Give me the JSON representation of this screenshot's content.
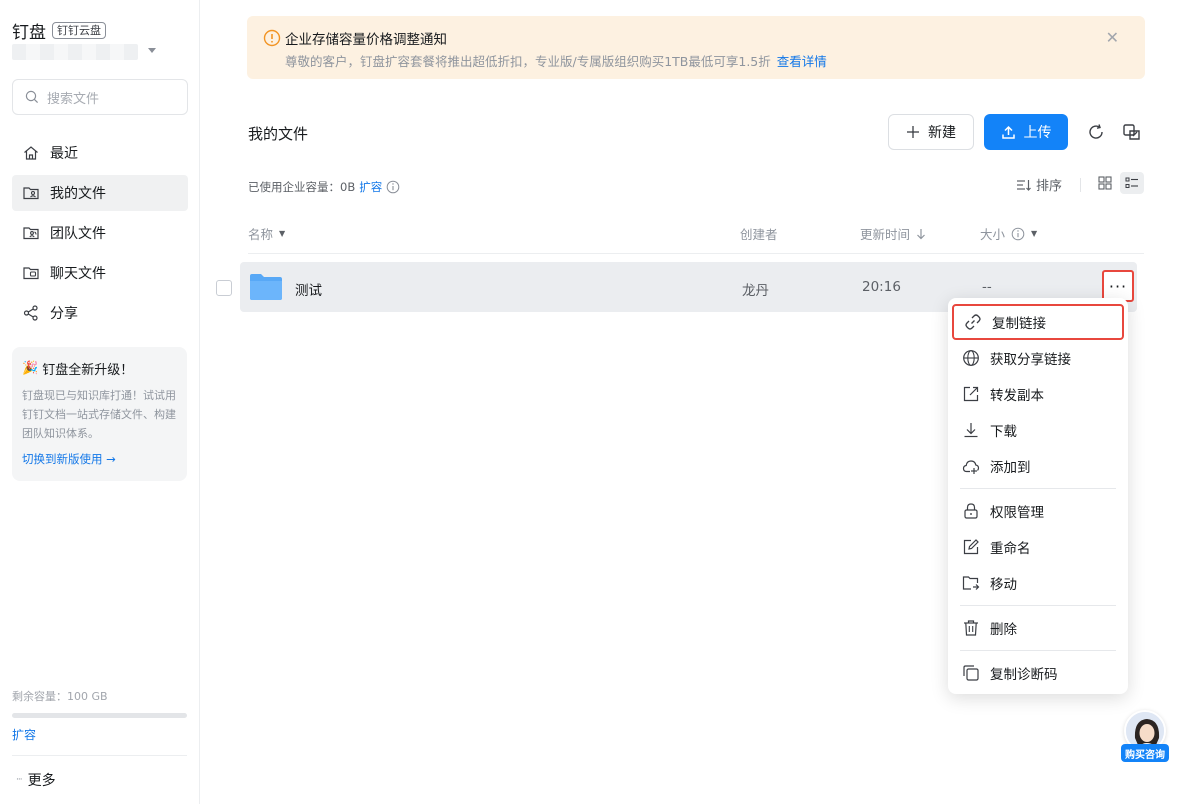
{
  "sidebar": {
    "brand_title": "钉盘",
    "brand_tag": "钉钉云盘",
    "search_placeholder": "搜索文件",
    "nav": [
      {
        "label": "最近",
        "icon": "home-icon"
      },
      {
        "label": "我的文件",
        "icon": "user-folder-icon",
        "active": true
      },
      {
        "label": "团队文件",
        "icon": "team-folder-icon"
      },
      {
        "label": "聊天文件",
        "icon": "chat-folder-icon"
      },
      {
        "label": "分享",
        "icon": "share-icon"
      }
    ],
    "promo": {
      "title": "钉盘全新升级！",
      "desc": "钉盘现已与知识库打通！试试用钉钉文档一站式存储文件、构建团队知识体系。",
      "link": "切换到新版使用 →"
    },
    "capacity_label": "剩余容量：100 GB",
    "capacity_used_fraction": 0,
    "expand_label": "扩容",
    "more_label": "更多"
  },
  "notice": {
    "title": "企业存储容量价格调整通知",
    "body": "尊敬的客户，钉盘扩容套餐将推出超低折扣，专业版/专属版组织购买1TB最低可享1.5折",
    "link": "查看详情"
  },
  "header": {
    "title": "我的文件",
    "new_label": "新建",
    "upload_label": "上传",
    "usage_text": "已使用企业容量：0B",
    "usage_link": "扩容",
    "sort_label": "排序"
  },
  "table": {
    "columns": {
      "name": "名称",
      "creator": "创建者",
      "updated": "更新时间",
      "size": "大小"
    },
    "rows": [
      {
        "name": "测试",
        "creator": "龙丹",
        "updated": "20:16",
        "size": "--"
      }
    ]
  },
  "menu": {
    "items": [
      {
        "label": "复制链接",
        "icon": "link-icon"
      },
      {
        "label": "获取分享链接",
        "icon": "globe-icon"
      },
      {
        "label": "转发副本",
        "icon": "forward-icon"
      },
      {
        "label": "下载",
        "icon": "download-icon"
      },
      {
        "label": "添加到",
        "icon": "cloud-add-icon"
      },
      {
        "label": "权限管理",
        "icon": "lock-icon"
      },
      {
        "label": "重命名",
        "icon": "edit-icon"
      },
      {
        "label": "移动",
        "icon": "move-folder-icon"
      },
      {
        "label": "删除",
        "icon": "trash-icon"
      },
      {
        "label": "复制诊断码",
        "icon": "copy-icon"
      }
    ]
  },
  "support": {
    "label": "购买咨询"
  },
  "colors": {
    "accent": "#1383f8",
    "link": "#1277e8",
    "highlight": "#e8473d",
    "notice_bg": "#fdf1e1"
  }
}
